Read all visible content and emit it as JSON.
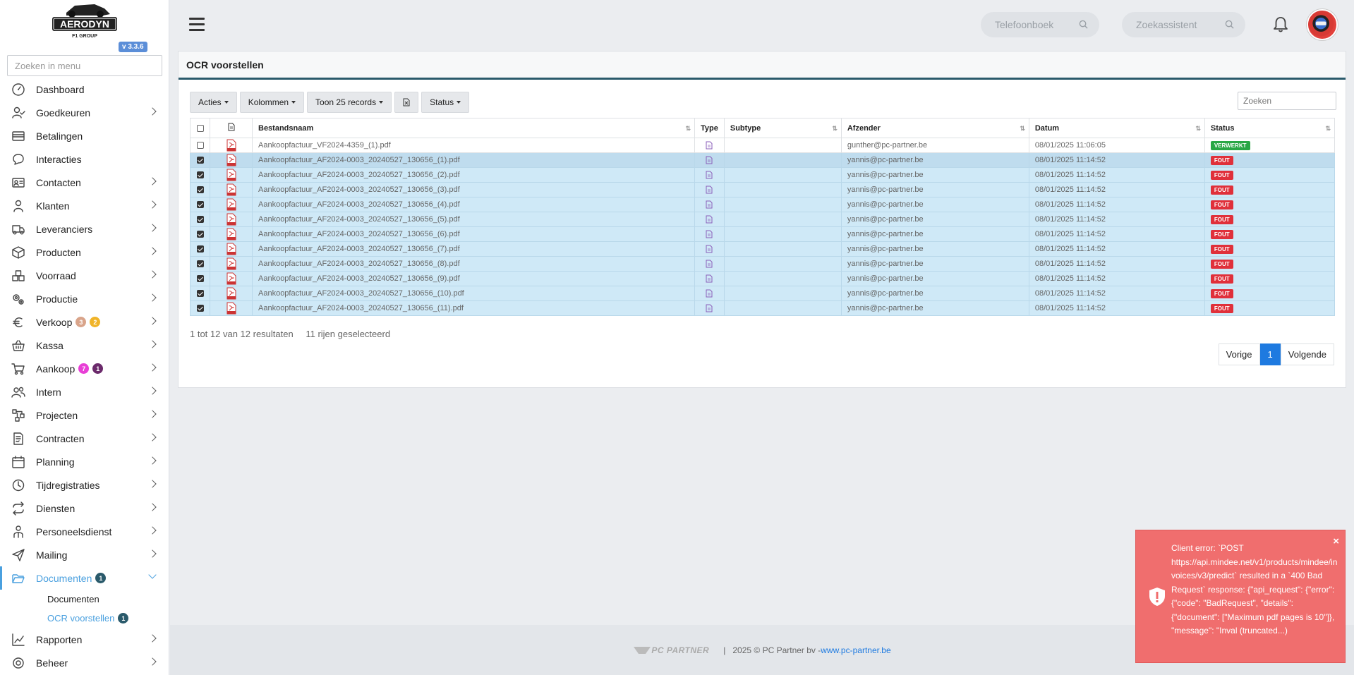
{
  "app": {
    "logo_text": "AERODYN",
    "logo_sub": "F1 GROUP",
    "version": "v 3.3.6"
  },
  "sidebar": {
    "search_placeholder": "Zoeken in menu",
    "items": [
      {
        "label": "Dashboard",
        "icon": "dashboard-icon",
        "chevron": false
      },
      {
        "label": "Goedkeuren",
        "icon": "user-check-icon",
        "chevron": true
      },
      {
        "label": "Betalingen",
        "icon": "payments-icon",
        "chevron": false
      },
      {
        "label": "Interacties",
        "icon": "chat-icon",
        "chevron": false
      },
      {
        "label": "Contacten",
        "icon": "contact-card-icon",
        "chevron": true
      },
      {
        "label": "Klanten",
        "icon": "person-icon",
        "chevron": true
      },
      {
        "label": "Leveranciers",
        "icon": "truck-icon",
        "chevron": true
      },
      {
        "label": "Producten",
        "icon": "box-icon",
        "chevron": true
      },
      {
        "label": "Voorraad",
        "icon": "boxes-icon",
        "chevron": true
      },
      {
        "label": "Productie",
        "icon": "gears-icon",
        "chevron": true
      },
      {
        "label": "Verkoop",
        "icon": "euro-icon",
        "chevron": true,
        "badges": [
          {
            "value": "3",
            "color": "#d9a48a"
          },
          {
            "value": "2",
            "color": "#f0b429"
          }
        ]
      },
      {
        "label": "Kassa",
        "icon": "basket-icon",
        "chevron": true
      },
      {
        "label": "Aankoop",
        "icon": "cart-icon",
        "chevron": true,
        "badges": [
          {
            "value": "7",
            "color": "#e83fd6"
          },
          {
            "value": "1",
            "color": "#6b2a6b"
          }
        ]
      },
      {
        "label": "Intern",
        "icon": "users-icon",
        "chevron": true
      },
      {
        "label": "Projecten",
        "icon": "project-icon",
        "chevron": true
      },
      {
        "label": "Contracten",
        "icon": "contract-icon",
        "chevron": true
      },
      {
        "label": "Planning",
        "icon": "calendar-icon",
        "chevron": true
      },
      {
        "label": "Tijdregistraties",
        "icon": "timer-icon",
        "chevron": true
      },
      {
        "label": "Diensten",
        "icon": "repeat-icon",
        "chevron": true
      },
      {
        "label": "Personeelsdienst",
        "icon": "staff-icon",
        "chevron": true
      },
      {
        "label": "Mailing",
        "icon": "send-icon",
        "chevron": true
      },
      {
        "label": "Documenten",
        "icon": "folder-open-icon",
        "chevron": true,
        "active": true,
        "badges": [
          {
            "value": "1",
            "color": "#2a5a6b"
          }
        ]
      }
    ],
    "subitems": [
      {
        "label": "Documenten",
        "active": false
      },
      {
        "label": "OCR voorstellen",
        "active": true,
        "badge": "1"
      }
    ],
    "after_items": [
      {
        "label": "Rapporten",
        "icon": "chart-line-icon",
        "chevron": true
      },
      {
        "label": "Beheer",
        "icon": "settings-icon",
        "chevron": true
      }
    ]
  },
  "topbar": {
    "phonebook_placeholder": "Telefoonboek",
    "search_assistant_placeholder": "Zoekassistent"
  },
  "panel": {
    "title": "OCR voorstellen",
    "toolbar": {
      "actions": "Acties",
      "columns": "Kolommen",
      "show_records": "Toon 25 records",
      "status": "Status"
    },
    "search_placeholder": "Zoeken",
    "columns": [
      "Bestandsnaam",
      "Type",
      "Subtype",
      "Afzender",
      "Datum",
      "Status"
    ],
    "rows": [
      {
        "checked": false,
        "file": "Aankoopfactuur_VF2024-4359_(1).pdf",
        "subtype": "",
        "sender": "gunther@pc-partner.be",
        "date": "08/01/2025 11:06:05",
        "status": "VERWERKT",
        "status_kind": "ok"
      },
      {
        "checked": true,
        "file": "Aankoopfactuur_AF2024-0003_20240527_130656_(1).pdf",
        "subtype": "",
        "sender": "yannis@pc-partner.be",
        "date": "08/01/2025 11:14:52",
        "status": "FOUT",
        "status_kind": "err"
      },
      {
        "checked": true,
        "file": "Aankoopfactuur_AF2024-0003_20240527_130656_(2).pdf",
        "subtype": "",
        "sender": "yannis@pc-partner.be",
        "date": "08/01/2025 11:14:52",
        "status": "FOUT",
        "status_kind": "err"
      },
      {
        "checked": true,
        "file": "Aankoopfactuur_AF2024-0003_20240527_130656_(3).pdf",
        "subtype": "",
        "sender": "yannis@pc-partner.be",
        "date": "08/01/2025 11:14:52",
        "status": "FOUT",
        "status_kind": "err"
      },
      {
        "checked": true,
        "file": "Aankoopfactuur_AF2024-0003_20240527_130656_(4).pdf",
        "subtype": "",
        "sender": "yannis@pc-partner.be",
        "date": "08/01/2025 11:14:52",
        "status": "FOUT",
        "status_kind": "err"
      },
      {
        "checked": true,
        "file": "Aankoopfactuur_AF2024-0003_20240527_130656_(5).pdf",
        "subtype": "",
        "sender": "yannis@pc-partner.be",
        "date": "08/01/2025 11:14:52",
        "status": "FOUT",
        "status_kind": "err"
      },
      {
        "checked": true,
        "file": "Aankoopfactuur_AF2024-0003_20240527_130656_(6).pdf",
        "subtype": "",
        "sender": "yannis@pc-partner.be",
        "date": "08/01/2025 11:14:52",
        "status": "FOUT",
        "status_kind": "err"
      },
      {
        "checked": true,
        "file": "Aankoopfactuur_AF2024-0003_20240527_130656_(7).pdf",
        "subtype": "",
        "sender": "yannis@pc-partner.be",
        "date": "08/01/2025 11:14:52",
        "status": "FOUT",
        "status_kind": "err"
      },
      {
        "checked": true,
        "file": "Aankoopfactuur_AF2024-0003_20240527_130656_(8).pdf",
        "subtype": "",
        "sender": "yannis@pc-partner.be",
        "date": "08/01/2025 11:14:52",
        "status": "FOUT",
        "status_kind": "err"
      },
      {
        "checked": true,
        "file": "Aankoopfactuur_AF2024-0003_20240527_130656_(9).pdf",
        "subtype": "",
        "sender": "yannis@pc-partner.be",
        "date": "08/01/2025 11:14:52",
        "status": "FOUT",
        "status_kind": "err"
      },
      {
        "checked": true,
        "file": "Aankoopfactuur_AF2024-0003_20240527_130656_(10).pdf",
        "subtype": "",
        "sender": "yannis@pc-partner.be",
        "date": "08/01/2025 11:14:52",
        "status": "FOUT",
        "status_kind": "err"
      },
      {
        "checked": true,
        "file": "Aankoopfactuur_AF2024-0003_20240527_130656_(11).pdf",
        "subtype": "",
        "sender": "yannis@pc-partner.be",
        "date": "08/01/2025 11:14:52",
        "status": "FOUT",
        "status_kind": "err"
      }
    ],
    "info": {
      "results": "1 tot 12 van 12 resultaten",
      "selected": "11 rijen geselecteerd"
    },
    "pager": {
      "prev": "Vorige",
      "current": "1",
      "next": "Volgende"
    }
  },
  "footer": {
    "brand": "PC PARTNER",
    "divider": "|",
    "copyright": "2025 © PC Partner bv - ",
    "link": "www.pc-partner.be"
  },
  "toast": {
    "message": "Client error: `POST https://api.mindee.net/v1/products/mindee/invoices/v3/predict` resulted in a `400 Bad Request` response: {\"api_request\": {\"error\": {\"code\": \"BadRequest\", \"details\": {\"document\": [\"Maximum pdf pages is 10\"]}, \"message\": \"Inval (truncated...)",
    "close": "×"
  },
  "colors": {
    "accent": "#4aa0df",
    "header_rule": "#2a5a6b",
    "selected_row": "#cfe9f7",
    "status_ok": "#29a745",
    "status_error": "#e0303a",
    "toast_bg": "#f06e6e",
    "pager_active": "#1e7ae0"
  }
}
